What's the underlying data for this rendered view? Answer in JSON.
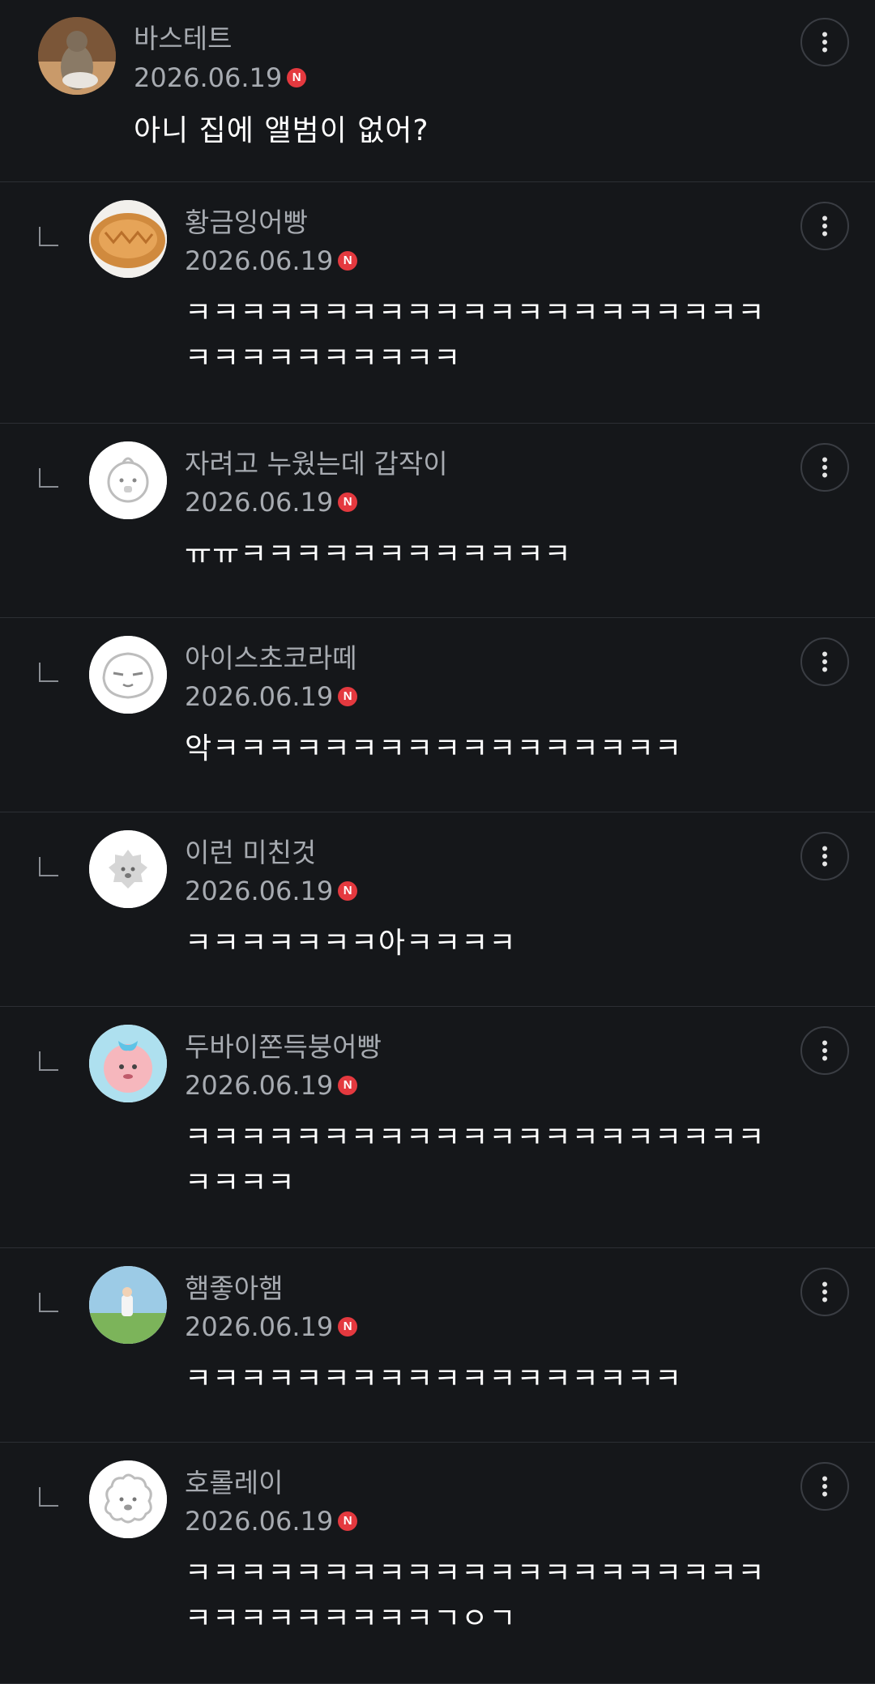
{
  "comments": [
    {
      "nick": "바스테트",
      "date": "2026.06.19",
      "badge": "N",
      "text": "아니 집에 앨범이 없어?",
      "avatar": "cat-photo"
    },
    {
      "nick": "황금잉어빵",
      "date": "2026.06.19",
      "badge": "N",
      "text": "ㅋㅋㅋㅋㅋㅋㅋㅋㅋㅋㅋㅋㅋㅋㅋㅋㅋㅋㅋㅋㅋㅋㅋㅋㅋㅋㅋㅋㅋㅋㅋ",
      "avatar": "fish-bread"
    },
    {
      "nick": "자려고 누웠는데 갑작이",
      "date": "2026.06.19",
      "badge": "N",
      "text": "ㅠㅠㅋㅋㅋㅋㅋㅋㅋㅋㅋㅋㅋㅋ",
      "avatar": "character-face"
    },
    {
      "nick": "아이스초코라떼",
      "date": "2026.06.19",
      "badge": "N",
      "text": "악ㅋㅋㅋㅋㅋㅋㅋㅋㅋㅋㅋㅋㅋㅋㅋㅋㅋ",
      "avatar": "character-face"
    },
    {
      "nick": "이런 미친것",
      "date": "2026.06.19",
      "badge": "N",
      "text": "ㅋㅋㅋㅋㅋㅋㅋ아ㅋㅋㅋㅋ",
      "avatar": "character-face"
    },
    {
      "nick": "두바이쫀득붕어빵",
      "date": "2026.06.19",
      "badge": "N",
      "text": "ㅋㅋㅋㅋㅋㅋㅋㅋㅋㅋㅋㅋㅋㅋㅋㅋㅋㅋㅋㅋㅋㅋㅋㅋㅋ",
      "avatar": "pink-character"
    },
    {
      "nick": "햄좋아햄",
      "date": "2026.06.19",
      "badge": "N",
      "text": "ㅋㅋㅋㅋㅋㅋㅋㅋㅋㅋㅋㅋㅋㅋㅋㅋㅋㅋ",
      "avatar": "field-photo"
    },
    {
      "nick": "호롤레이",
      "date": "2026.06.19",
      "badge": "N",
      "text": "ㅋㅋㅋㅋㅋㅋㅋㅋㅋㅋㅋㅋㅋㅋㅋㅋㅋㅋㅋㅋㅋㅋㅋㅋㅋㅋㅋㅋㅋㅋㄱㅇㄱ",
      "avatar": "character-face"
    }
  ],
  "icons": {
    "more": "more-vertical-icon",
    "reply": "reply-indent-icon"
  },
  "colors": {
    "background": "#15171a",
    "text": "#ffffff",
    "meta": "#a7abb1",
    "badge": "#e4393f"
  }
}
